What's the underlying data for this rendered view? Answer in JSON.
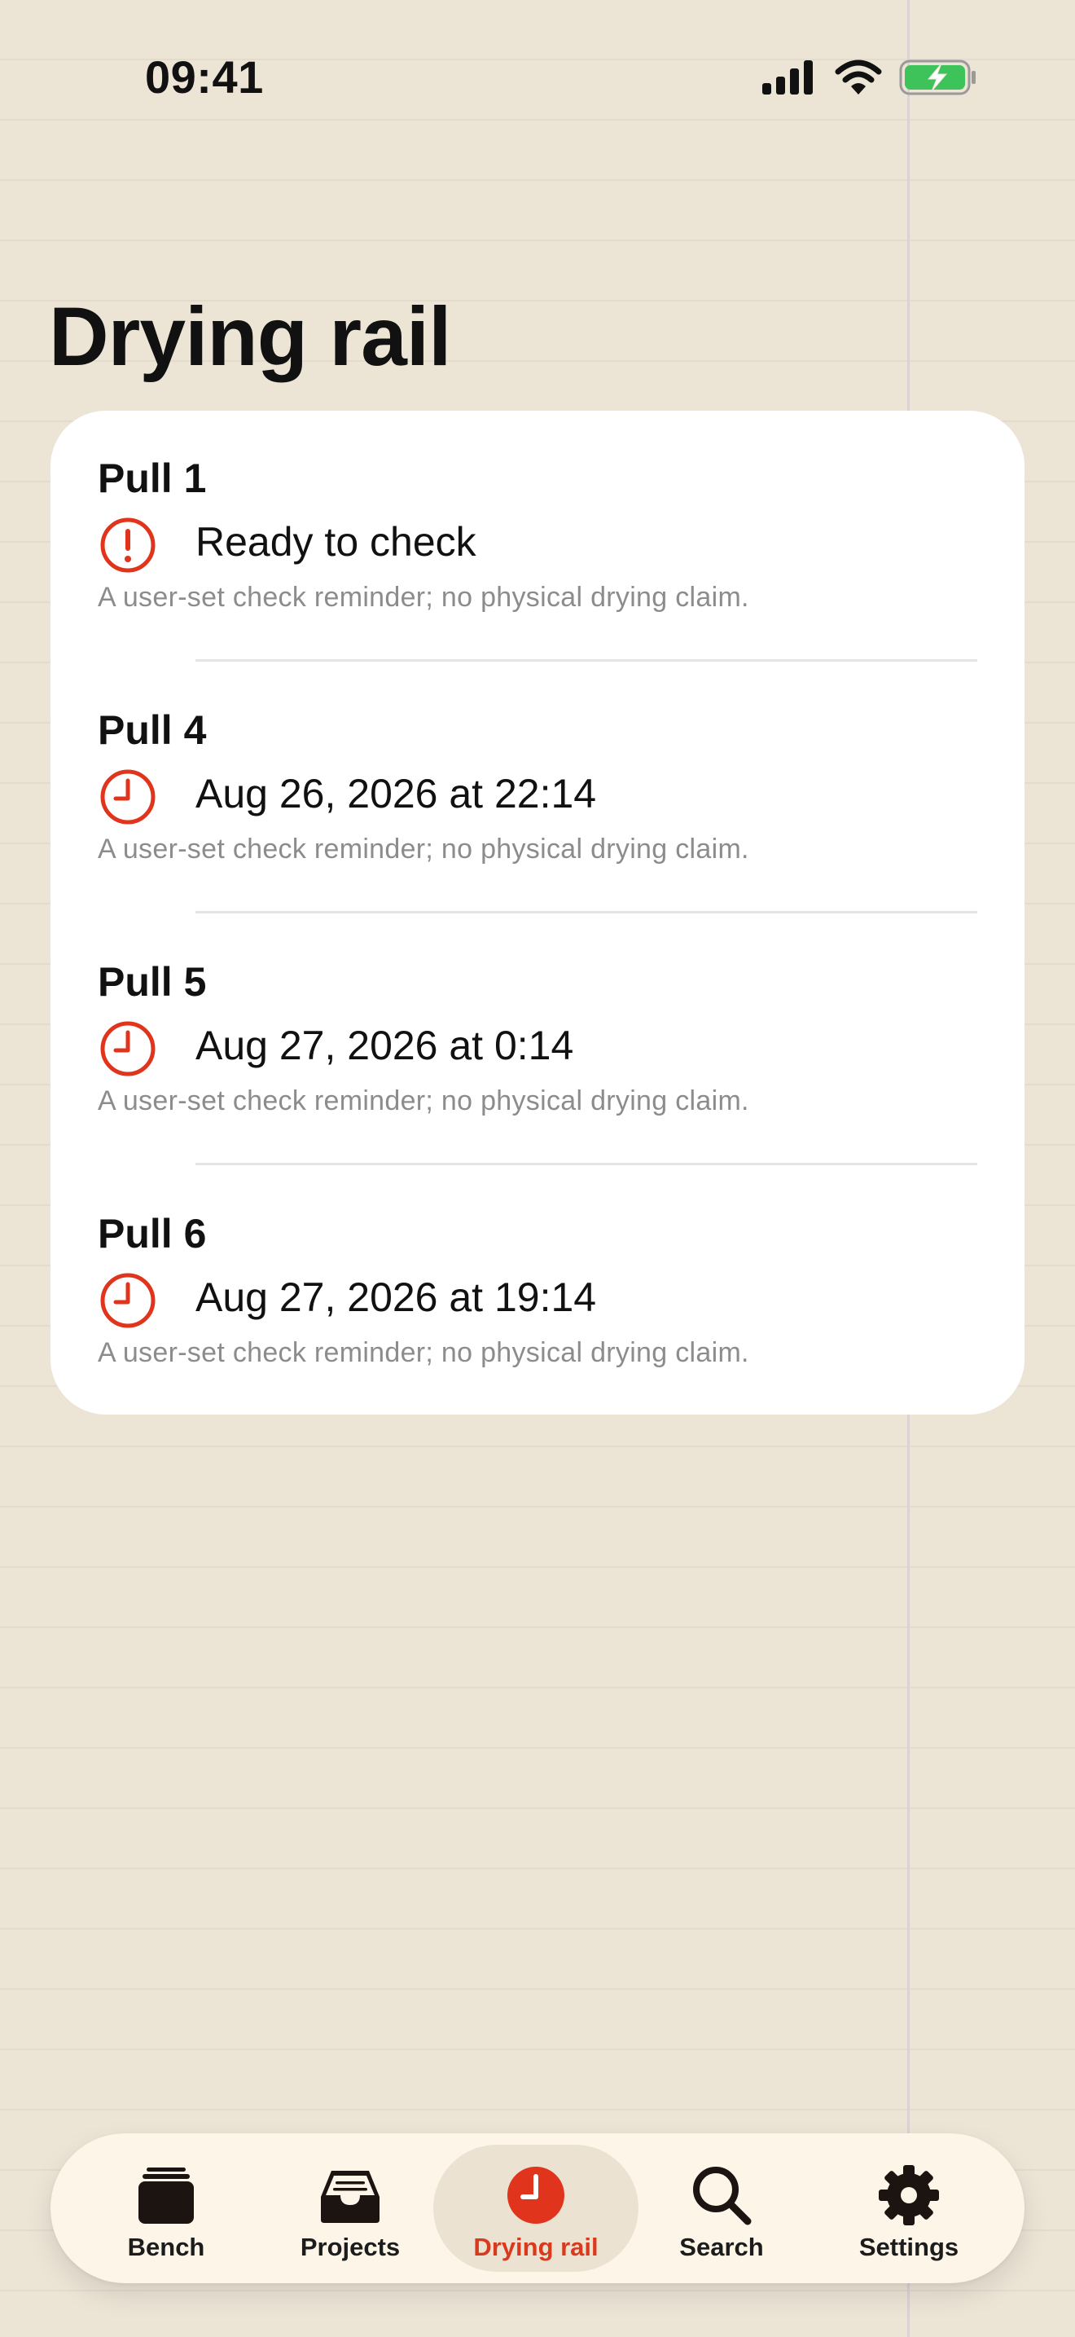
{
  "status_bar": {
    "time": "09:41"
  },
  "page": {
    "title": "Drying rail"
  },
  "accent_color": "#e0341c",
  "reminders": [
    {
      "name": "Pull 1",
      "icon": "exclamation-circle-icon",
      "when": "Ready to check",
      "note": "A user-set check reminder; no physical drying claim."
    },
    {
      "name": "Pull 4",
      "icon": "clock-icon",
      "when": "Aug 26, 2026 at 22:14",
      "note": "A user-set check reminder; no physical drying claim."
    },
    {
      "name": "Pull 5",
      "icon": "clock-icon",
      "when": "Aug 27, 2026 at 0:14",
      "note": "A user-set check reminder; no physical drying claim."
    },
    {
      "name": "Pull 6",
      "icon": "clock-icon",
      "when": "Aug 27, 2026 at 19:14",
      "note": "A user-set check reminder; no physical drying claim."
    }
  ],
  "tab_bar": {
    "selected": "Drying rail",
    "tabs": [
      {
        "label": "Bench",
        "icon": "stack-icon"
      },
      {
        "label": "Projects",
        "icon": "tray-icon"
      },
      {
        "label": "Drying rail",
        "icon": "clock-fill-icon"
      },
      {
        "label": "Search",
        "icon": "magnifier-icon"
      },
      {
        "label": "Settings",
        "icon": "gear-icon"
      }
    ]
  }
}
